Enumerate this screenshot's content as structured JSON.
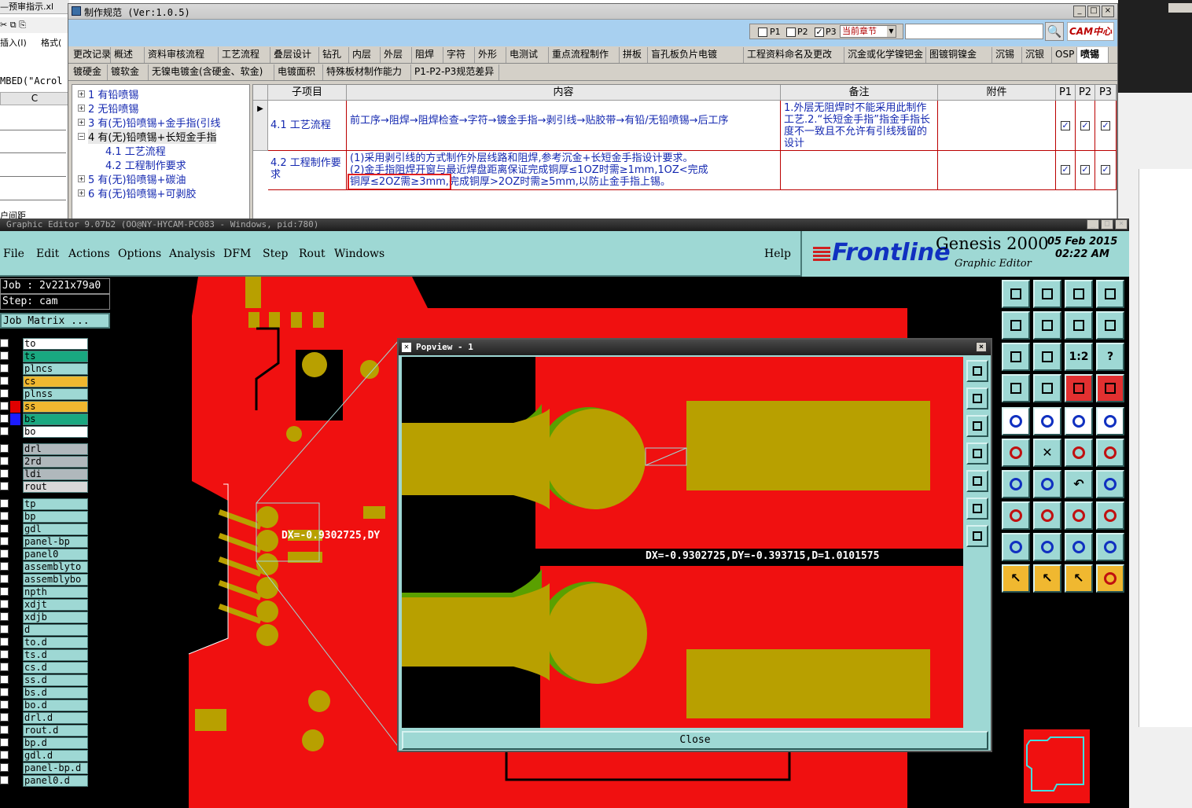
{
  "excel": {
    "tab": "—预审指示.xl",
    "insert": "插入(I)",
    "format": "格式(",
    "formula": "MBED(\"Acrol",
    "col": "C",
    "cut": "户间距"
  },
  "spec": {
    "title": "制作规范 (Ver:1.0.5)",
    "filters": {
      "p1": "P1",
      "p2": "P2",
      "p3": "P3",
      "scope": "当前章节"
    },
    "logo": "CAM中心",
    "tabs_row1": [
      "更改记录",
      "概述",
      "资料审核流程",
      "工艺流程",
      "叠层设计",
      "钻孔",
      "内层",
      "外层",
      "阻焊",
      "字符",
      "外形",
      "电测试",
      "重点流程制作",
      "拼板",
      "盲孔板负片电镀",
      "工程资料命名及更改",
      "沉金或化学镍钯金",
      "图镀铜镍金",
      "沉锡",
      "沉银",
      "OSP",
      "喷锡"
    ],
    "tabs_row2": [
      "镀硬金",
      "镀软金",
      "无镍电镀金(含硬金、软金)",
      "电镀面积",
      "特殊板材制作能力",
      "P1-P2-P3规范差异"
    ],
    "tree": [
      "1 有铅喷锡",
      "2 无铅喷锡",
      "3 有(无)铅喷锡+金手指(引线",
      "4 有(无)铅喷锡+长短金手指",
      "4.1 工艺流程",
      "4.2 工程制作要求",
      "5 有(无)铅喷锡+碳油",
      "6 有(无)铅喷锡+可剥胶"
    ],
    "headers": {
      "sub": "子项目",
      "content": "内容",
      "note": "备注",
      "attach": "附件",
      "p1": "P1",
      "p2": "P2",
      "p3": "P3"
    },
    "rows": [
      {
        "sub": "4.1 工艺流程",
        "content": "前工序→阻焊→阻焊检查→字符→镀金手指→剥引线→贴胶带→有铅/无铅喷锡→后工序",
        "note": "1.外层无阻焊时不能采用此制作工艺.2.“长短金手指”指金手指长度不一致且不允许有引线残留的设计"
      },
      {
        "sub": "4.2 工程制作要求",
        "content1": "(1)采用剥引线的方式制作外层线路和阻焊,参考沉金+长短金手指设计要求。",
        "content2": "(2)金手指阻焊开窗与最近焊盘距离保证完成铜厚≤1OZ时需≥1mm,1OZ<完成",
        "content3_hl": "铜厚≤2OZ需≥3mm,",
        "content3": "完成铜厚>2OZ时需≥5mm,以防止金手指上锡。",
        "note": ""
      }
    ]
  },
  "genesis": {
    "title": "Graphic Editor 9.07b2 (OO@NY-HYCAM-PC083 - Windows, pid:780)",
    "menus": [
      "File",
      "Edit",
      "Actions",
      "Options",
      "Analysis",
      "DFM",
      "Step",
      "Rout",
      "Windows"
    ],
    "help": "Help",
    "brand": "Frontline",
    "product": "Genesis 2000",
    "subtitle": "Graphic Editor",
    "date": "05 Feb 2015",
    "time": "02:22 AM",
    "job": "Job : 2v221x79a0",
    "step": "Step: cam",
    "matrix": "Job Matrix ...",
    "layers": [
      {
        "n": "to",
        "c": "#fff",
        "k": "#000"
      },
      {
        "n": "ts",
        "c": "#19a880",
        "k": "#000"
      },
      {
        "n": "plncs",
        "c": "#9ed8d4",
        "k": "#000"
      },
      {
        "n": "cs",
        "c": "#f0b830",
        "k": "#000"
      },
      {
        "n": "plnss",
        "c": "#9ed8d4",
        "k": "#000"
      },
      {
        "n": "ss",
        "c": "#f0b830",
        "k": "#e00000"
      },
      {
        "n": "bs",
        "c": "#19a880",
        "k": "#1c1cff"
      },
      {
        "n": "bo",
        "c": "#fff",
        "k": "#000"
      },
      {
        "n": "drl",
        "c": "#b0b8bc",
        "k": "#000"
      },
      {
        "n": "2rd",
        "c": "#b0b8bc",
        "k": "#000"
      },
      {
        "n": "ldi",
        "c": "#b0b8bc",
        "k": "#000"
      },
      {
        "n": "rout",
        "c": "#d8d8d8",
        "k": "#000"
      },
      {
        "n": "tp",
        "c": "#9ed8d4",
        "k": "#000"
      },
      {
        "n": "bp",
        "c": "#9ed8d4",
        "k": "#000"
      },
      {
        "n": "gdl",
        "c": "#9ed8d4",
        "k": "#000"
      },
      {
        "n": "panel-bp",
        "c": "#9ed8d4",
        "k": "#000"
      },
      {
        "n": "panel0",
        "c": "#9ed8d4",
        "k": "#000"
      },
      {
        "n": "assemblyto",
        "c": "#9ed8d4",
        "k": "#000"
      },
      {
        "n": "assemblybo",
        "c": "#9ed8d4",
        "k": "#000"
      },
      {
        "n": "npth",
        "c": "#9ed8d4",
        "k": "#000"
      },
      {
        "n": "xdjt",
        "c": "#9ed8d4",
        "k": "#000"
      },
      {
        "n": "xdjb",
        "c": "#9ed8d4",
        "k": "#000"
      },
      {
        "n": "d",
        "c": "#9ed8d4",
        "k": "#000"
      },
      {
        "n": "to.d",
        "c": "#9ed8d4",
        "k": "#000"
      },
      {
        "n": "ts.d",
        "c": "#9ed8d4",
        "k": "#000"
      },
      {
        "n": "cs.d",
        "c": "#9ed8d4",
        "k": "#000"
      },
      {
        "n": "ss.d",
        "c": "#9ed8d4",
        "k": "#000"
      },
      {
        "n": "bs.d",
        "c": "#9ed8d4",
        "k": "#000"
      },
      {
        "n": "bo.d",
        "c": "#9ed8d4",
        "k": "#000"
      },
      {
        "n": "drl.d",
        "c": "#9ed8d4",
        "k": "#000"
      },
      {
        "n": "rout.d",
        "c": "#9ed8d4",
        "k": "#000"
      },
      {
        "n": "bp.d",
        "c": "#9ed8d4",
        "k": "#000"
      },
      {
        "n": "gdl.d",
        "c": "#9ed8d4",
        "k": "#000"
      },
      {
        "n": "panel-bp.d",
        "c": "#9ed8d4",
        "k": "#000"
      },
      {
        "n": "panel0.d",
        "c": "#9ed8d4",
        "k": "#000"
      }
    ],
    "measure_short": "DX=-0.9302725,DY",
    "popview": {
      "title": "Popview - 1",
      "measure": "DX=-0.9302725,DY=-0.393715,D=1.0101575",
      "close": "Close",
      "ratio": "1:2"
    }
  },
  "colors": {
    "copper": "#f01010",
    "gold": "#b8a000",
    "green": "#5aa000",
    "teal": "#9ed8d4",
    "link": "#1428b0",
    "highlight": "#e00000"
  }
}
